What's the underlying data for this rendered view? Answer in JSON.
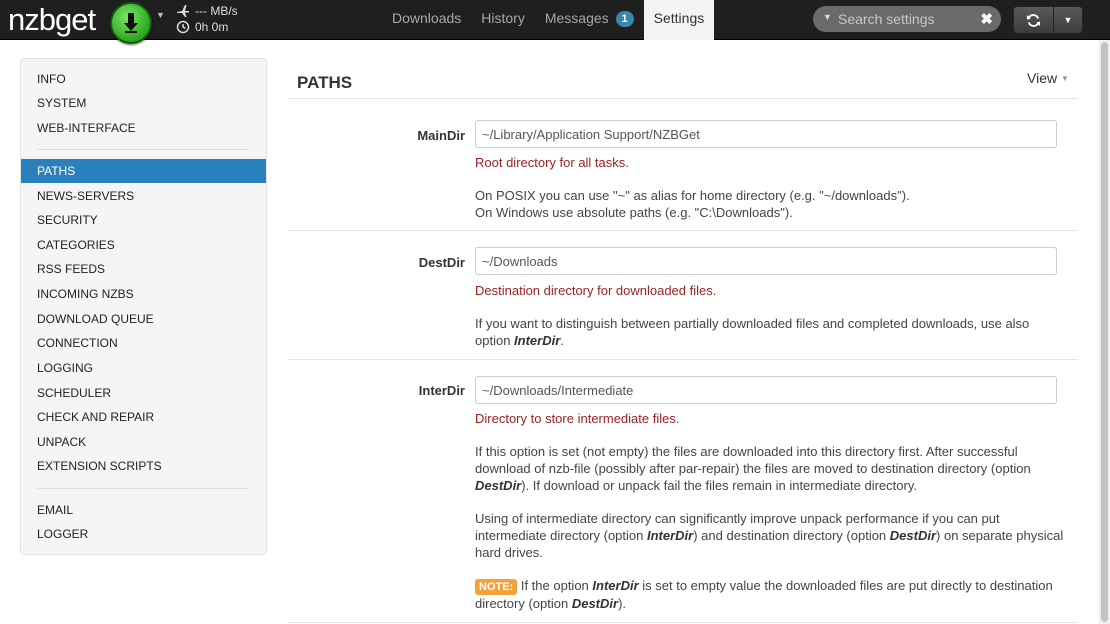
{
  "app": {
    "logo_text": "nzbget",
    "speed": "--- MB/s",
    "time_left": "0h 0m"
  },
  "nav_tabs": [
    {
      "label": "Downloads"
    },
    {
      "label": "History"
    },
    {
      "label": "Messages",
      "badge": "1"
    },
    {
      "label": "Settings",
      "active": true
    }
  ],
  "search": {
    "placeholder": "Search settings"
  },
  "sidebar": {
    "items": [
      {
        "label": "INFO"
      },
      {
        "label": "SYSTEM"
      },
      {
        "label": "WEB-INTERFACE"
      },
      {
        "label": "PATHS",
        "active": true
      },
      {
        "label": "NEWS-SERVERS"
      },
      {
        "label": "SECURITY"
      },
      {
        "label": "CATEGORIES"
      },
      {
        "label": "RSS FEEDS"
      },
      {
        "label": "INCOMING NZBS"
      },
      {
        "label": "DOWNLOAD QUEUE"
      },
      {
        "label": "CONNECTION"
      },
      {
        "label": "LOGGING"
      },
      {
        "label": "SCHEDULER"
      },
      {
        "label": "CHECK AND REPAIR"
      },
      {
        "label": "UNPACK"
      },
      {
        "label": "EXTENSION SCRIPTS"
      },
      {
        "label": "EMAIL"
      },
      {
        "label": "LOGGER"
      }
    ]
  },
  "main": {
    "title": "PATHS",
    "view_label": "View",
    "options": [
      {
        "name": "MainDir",
        "value": "~/Library/Application Support/NZBGet",
        "help": "Root directory for all tasks.",
        "desc1": "On POSIX you can use \"~\" as alias for home directory (e.g. \"~/downloads\").",
        "desc2": "On Windows use absolute paths (e.g. \"C:\\Downloads\")."
      },
      {
        "name": "DestDir",
        "value": "~/Downloads",
        "help": "Destination directory for downloaded files.",
        "desc_pre": "If you want to distinguish between partially downloaded files and completed downloads, use also option ",
        "desc_ref": "InterDir",
        "desc_post": "."
      },
      {
        "name": "InterDir",
        "value": "~/Downloads/Intermediate",
        "help": "Directory to store intermediate files.",
        "p1_pre": "If this option is set (not empty) the files are downloaded into this directory first. After successful download of nzb-file (possibly after par-repair) the files are moved to destination directory (option ",
        "p1_ref": "DestDir",
        "p1_post": "). If download or unpack fail the files remain in intermediate directory.",
        "p2_pre": "Using of intermediate directory can significantly improve unpack performance if you can put intermediate directory (option ",
        "p2_ref1": "InterDir",
        "p2_mid": ") and destination directory (option ",
        "p2_ref2": "DestDir",
        "p2_post": ") on separate physical hard drives.",
        "note_label": "NOTE:",
        "note_pre": " If the option ",
        "note_ref1": "InterDir",
        "note_mid": " is set to empty value the downloaded files are put directly to destination directory (option ",
        "note_ref2": "DestDir",
        "note_post": ")."
      }
    ]
  },
  "colors": {
    "navbar": "#1f1f1f",
    "active_nav": "#2a7fbd",
    "help_text": "#9a1f1f",
    "note_badge": "#f0a33a",
    "download_button": "#2da81e"
  }
}
